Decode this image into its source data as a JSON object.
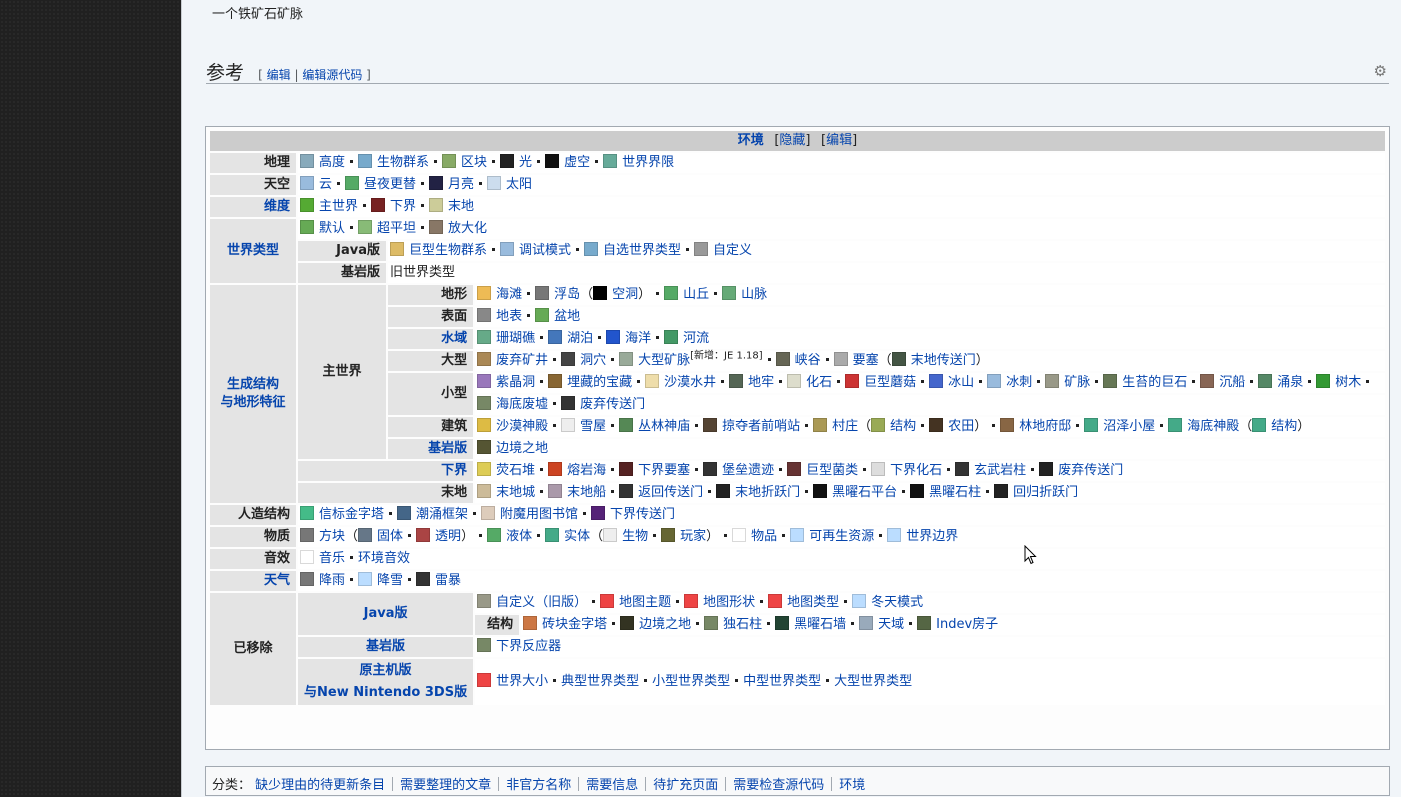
{
  "intro_text": "一个铁矿石矿脉",
  "section": {
    "title": "参考",
    "edit": "编辑",
    "edit_source": "编辑源代码"
  },
  "navbox": {
    "title": "环境",
    "hide": "隐藏",
    "edit": "编辑",
    "rows": {
      "geo": {
        "label": "地理",
        "items": [
          "高度",
          "生物群系",
          "区块",
          "光",
          "虚空",
          "世界界限"
        ]
      },
      "sky": {
        "label": "天空",
        "items": [
          "云",
          "昼夜更替",
          "月亮",
          "太阳"
        ]
      },
      "dim": {
        "label": "维度",
        "items": [
          "主世界",
          "下界",
          "末地"
        ]
      },
      "wt": {
        "label": "世界类型",
        "items": [
          "默认",
          "超平坦",
          "放大化"
        ],
        "java": {
          "label": "Java版",
          "items": [
            "巨型生物群系",
            "调试模式",
            "自选世界类型",
            "自定义"
          ]
        },
        "bedrock": {
          "label": "基岩版",
          "text": "旧世界类型"
        }
      },
      "gen": {
        "label1": "生成结构",
        "label2": "与地形特征",
        "ow": {
          "label": "主世界",
          "terrain": {
            "label": "地形",
            "items": [
              "海滩",
              "浮岛",
              "空洞",
              "山丘",
              "山脉"
            ]
          },
          "surface": {
            "label": "表面",
            "items": [
              "地表",
              "盆地"
            ]
          },
          "water": {
            "label": "水域",
            "items": [
              "珊瑚礁",
              "湖泊",
              "海洋",
              "河流"
            ]
          },
          "large": {
            "label": "大型",
            "items": [
              "废弃矿井",
              "洞穴",
              "大型矿脉",
              "峡谷",
              "要塞",
              "末地传送门"
            ],
            "sup": "[新增：JE 1.18]"
          },
          "small": {
            "label": "小型",
            "items": [
              "紫晶洞",
              "埋藏的宝藏",
              "沙漠水井",
              "地牢",
              "化石",
              "巨型蘑菇",
              "冰山",
              "冰刺",
              "矿脉",
              "生苔的巨石",
              "沉船",
              "涌泉",
              "树木",
              "海底废墟",
              "废弃传送门"
            ]
          },
          "build": {
            "label": "建筑",
            "items": [
              "沙漠神殿",
              "雪屋",
              "丛林神庙",
              "掠夺者前哨站",
              "村庄",
              "结构",
              "农田",
              "林地府邸",
              "沼泽小屋",
              "海底神殿",
              "结构"
            ]
          },
          "bedrock": {
            "label": "基岩版",
            "items": [
              "边境之地"
            ]
          }
        },
        "nether": {
          "label": "下界",
          "items": [
            "荧石堆",
            "熔岩海",
            "下界要塞",
            "堡垒遗迹",
            "巨型菌类",
            "下界化石",
            "玄武岩柱",
            "废弃传送门"
          ]
        },
        "end": {
          "label": "末地",
          "items": [
            "末地城",
            "末地船",
            "返回传送门",
            "末地折跃门",
            "黑曜石平台",
            "黑曜石柱",
            "回归折跃门"
          ]
        }
      },
      "man": {
        "label": "人造结构",
        "items": [
          "信标金字塔",
          "潮涌框架",
          "附魔用图书馆",
          "下界传送门"
        ]
      },
      "mat": {
        "label": "物质",
        "items": [
          "方块",
          "固体",
          "透明",
          "液体",
          "实体",
          "生物",
          "玩家",
          "物品",
          "可再生资源",
          "世界边界"
        ]
      },
      "snd": {
        "label": "音效",
        "items": [
          "音乐",
          "环境音效"
        ]
      },
      "wea": {
        "label": "天气",
        "items": [
          "降雨",
          "降雪",
          "雷暴"
        ]
      },
      "rem": {
        "label": "已移除",
        "java": {
          "label": "Java版",
          "items": [
            "自定义（旧版）",
            "地图主题",
            "地图形状",
            "地图类型",
            "冬天模式"
          ],
          "struct": {
            "label": "结构",
            "items": [
              "砖块金字塔",
              "边境之地",
              "独石柱",
              "黑曜石墙",
              "天域",
              "Indev房子"
            ]
          }
        },
        "bedrock": {
          "label": "基岩版",
          "items": [
            "下界反应器"
          ]
        },
        "console": {
          "label1": "原主机版",
          "label2": "与New Nintendo 3DS版",
          "items": [
            "世界大小",
            "典型世界类型",
            "小型世界类型",
            "中型世界类型",
            "大型世界类型"
          ]
        }
      }
    }
  },
  "categories": {
    "label": "分类：",
    "items": [
      "缺少理由的待更新条目",
      "需要整理的文章",
      "非官方名称",
      "需要信息",
      "待扩充页面",
      "需要检查源代码",
      "环境"
    ]
  }
}
